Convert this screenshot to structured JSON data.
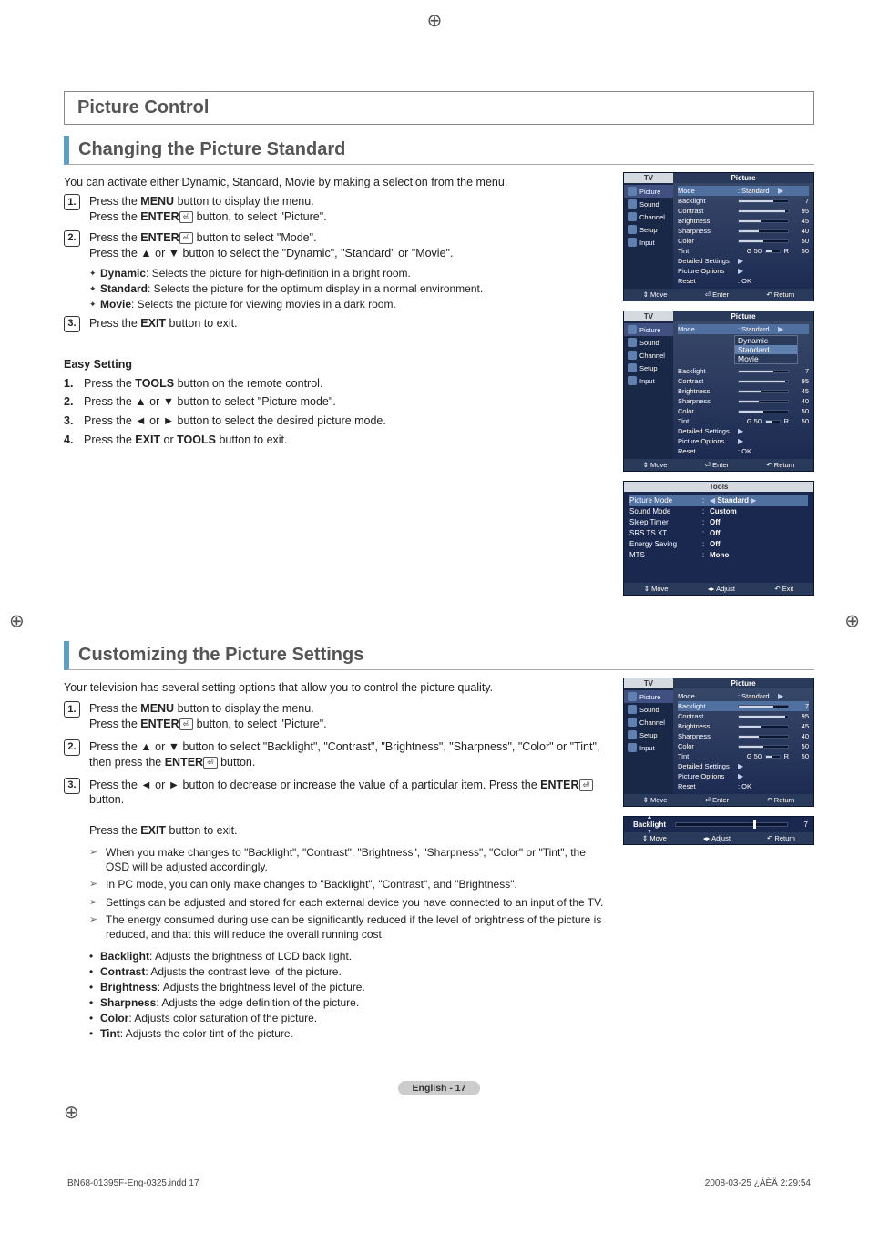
{
  "header": {
    "title": "Picture Control"
  },
  "section1": {
    "heading": "Changing the Picture Standard",
    "intro": "You can activate either Dynamic, Standard, Movie by making a selection from the menu.",
    "steps": [
      {
        "n": "1.",
        "a": "Press the ",
        "b": "MENU",
        "c": " button to display the menu.",
        "d": "Press the ",
        "e": "ENTER",
        "f": " button, to select \"Picture\"."
      },
      {
        "n": "2.",
        "a": "Press the ",
        "b": "ENTER",
        "c": " button to select \"Mode\".",
        "d": "Press the ▲ or ▼ button to select the \"Dynamic\", \"Standard\" or \"Movie\"."
      },
      {
        "n": "3.",
        "a": "Press the ",
        "b": "EXIT",
        "c": " button to exit."
      }
    ],
    "modes": [
      {
        "name": "Dynamic",
        "desc": ": Selects the picture for high-definition in a bright room."
      },
      {
        "name": "Standard",
        "desc": ": Selects the picture for the optimum display in a normal environment."
      },
      {
        "name": "Movie",
        "desc": ": Selects the picture for viewing movies in a dark room."
      }
    ],
    "easy": {
      "heading": "Easy Setting",
      "steps": [
        {
          "n": "1.",
          "t": "Press the <b>TOOLS</b> button on the remote control."
        },
        {
          "n": "2.",
          "t": "Press the ▲ or ▼ button to select \"Picture mode\"."
        },
        {
          "n": "3.",
          "t": "Press the ◄ or ► button to select the desired picture mode."
        },
        {
          "n": "4.",
          "t": "Press the <b>EXIT</b> or <b>TOOLS</b> button to exit."
        }
      ]
    }
  },
  "section2": {
    "heading": "Customizing the Picture Settings",
    "intro": "Your television has several setting options that allow you to control the picture quality.",
    "steps": [
      {
        "n": "1.",
        "html": "Press the <b>MENU</b> button to display the menu.<br>Press the <b>ENTER</b><span class='enter-icon'>⏎</span> button, to select \"Picture\"."
      },
      {
        "n": "2.",
        "html": "Press the ▲ or ▼ button to select \"Backlight\", \"Contrast\", \"Brightness\", \"Sharpness\", \"Color\" or \"Tint\", then press the <b>ENTER</b><span class='enter-icon'>⏎</span> button."
      },
      {
        "n": "3.",
        "html": "Press the ◄ or ► button to decrease or increase the value of a particular item. Press the <b>ENTER</b><span class='enter-icon'>⏎</span> button.<br><br>Press the <b>EXIT</b> button to exit."
      }
    ],
    "notes": [
      "When you make changes to \"Backlight\", \"Contrast\", \"Brightness\", \"Sharpness\", \"Color\" or \"Tint\", the OSD will be adjusted accordingly.",
      "In PC mode, you can only make changes to \"Backlight\", \"Contrast\", and \"Brightness\".",
      "Settings can be adjusted and stored for each external device you have connected to an input of the TV.",
      "The energy consumed during use can be significantly reduced if the level of brightness of the picture is reduced, and that this will reduce the overall running cost."
    ],
    "defs": [
      {
        "name": "Backlight",
        "desc": ": Adjusts the brightness of LCD back light."
      },
      {
        "name": "Contrast",
        "desc": ": Adjusts the contrast level of the picture."
      },
      {
        "name": "Brightness",
        "desc": ": Adjusts the brightness level of the picture."
      },
      {
        "name": "Sharpness",
        "desc": ": Adjusts the edge definition  of the picture."
      },
      {
        "name": "Color",
        "desc": ": Adjusts color saturation of the picture."
      },
      {
        "name": "Tint",
        "desc": ": Adjusts the color tint of the picture."
      }
    ]
  },
  "osd": {
    "tv_label": "TV",
    "picture_label": "Picture",
    "side_items": [
      "Picture",
      "Sound",
      "Channel",
      "Setup",
      "Input"
    ],
    "rows": [
      {
        "label": "Mode",
        "val": ": Standard",
        "arrow": true
      },
      {
        "label": "Backlight",
        "slider": 70,
        "num": "7"
      },
      {
        "label": "Contrast",
        "slider": 95,
        "num": "95"
      },
      {
        "label": "Brightness",
        "slider": 45,
        "num": "45"
      },
      {
        "label": "Sharpness",
        "slider": 40,
        "num": "40"
      },
      {
        "label": "Color",
        "slider": 50,
        "num": "50"
      },
      {
        "label": "Tint",
        "prefix": "G  50",
        "slider": 50,
        "suffix": "R",
        "num": "50"
      },
      {
        "label": "Detailed Settings",
        "arrow": true
      },
      {
        "label": "Picture Options",
        "arrow": true
      },
      {
        "label": "Reset",
        "val": ": OK"
      }
    ],
    "footer": [
      "⇕ Move",
      "⏎ Enter",
      "↶ Return"
    ]
  },
  "osd2": {
    "rows_highlight": "Mode",
    "dropdown": [
      "Dynamic",
      "Standard",
      "Movie"
    ],
    "sel": "Standard"
  },
  "tools": {
    "title": "Tools",
    "rows": [
      {
        "label": "Picture Mode",
        "val": "Standard",
        "sel": true,
        "arrows": true
      },
      {
        "label": "Sound Mode",
        "val": "Custom"
      },
      {
        "label": "Sleep Timer",
        "val": "Off"
      },
      {
        "label": "SRS TS XT",
        "val": "Off"
      },
      {
        "label": "Energy Saving",
        "val": "Off"
      },
      {
        "label": "MTS",
        "val": "Mono"
      }
    ],
    "footer": [
      "⇕ Move",
      "◂▸ Adjust",
      "↶ Exit"
    ]
  },
  "backlight": {
    "label": "Backlight",
    "value": "7",
    "pos": 70,
    "footer": [
      "⇕ Move",
      "◂▸ Adjust",
      "↶ Return"
    ]
  },
  "page": {
    "badge": "English - 17"
  },
  "footer": {
    "left": "BN68-01395F-Eng-0325.indd   17",
    "right": "2008-03-25   ¿ÀÈÄ 2:29:54"
  }
}
